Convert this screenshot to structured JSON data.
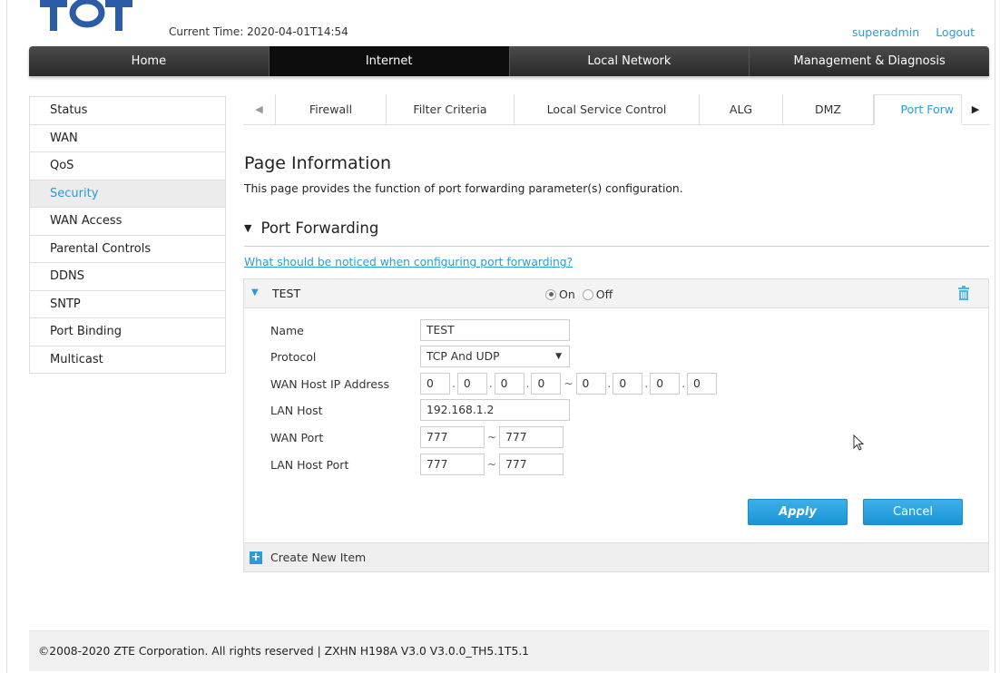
{
  "header": {
    "logo_text": "TOT",
    "current_time_label": "Current Time: 2020-04-01T14:54",
    "user": "superadmin",
    "logout": "Logout"
  },
  "main_nav": [
    "Home",
    "Internet",
    "Local Network",
    "Management & Diagnosis"
  ],
  "main_nav_active": "Internet",
  "sidebar": {
    "items": [
      "Status",
      "WAN",
      "QoS",
      "Security",
      "WAN Access",
      "Parental Controls",
      "DDNS",
      "SNTP",
      "Port Binding",
      "Multicast"
    ],
    "active": "Security"
  },
  "tabs": {
    "items": [
      "Firewall",
      "Filter Criteria",
      "Local Service Control",
      "ALG",
      "DMZ",
      "Port Forw"
    ],
    "active": "Port Forw"
  },
  "page": {
    "title": "Page Information",
    "description": "This page provides the function of port forwarding parameter(s) configuration.",
    "section_title": "Port Forwarding",
    "notice_link": "What should be noticed when configuring port forwarding?"
  },
  "item": {
    "name": "TEST",
    "on_label": "On",
    "off_label": "Off",
    "state": "On",
    "fields": {
      "name_label": "Name",
      "name_value": "TEST",
      "protocol_label": "Protocol",
      "protocol_value": "TCP And UDP",
      "wan_host_ip_label": "WAN Host IP Address",
      "wan_host_ip_start": [
        "0",
        "0",
        "0",
        "0"
      ],
      "wan_host_ip_end": [
        "0",
        "0",
        "0",
        "0"
      ],
      "lan_host_label": "LAN Host",
      "lan_host_value": "192.168.1.2",
      "wan_port_label": "WAN Port",
      "wan_port_start": "777",
      "wan_port_end": "777",
      "lan_host_port_label": "LAN Host Port",
      "lan_host_port_start": "777",
      "lan_host_port_end": "777"
    },
    "apply_label": "Apply",
    "cancel_label": "Cancel",
    "create_new_label": "Create New Item"
  },
  "footer": {
    "copyright": "©2008-2020 ZTE Corporation. All rights reserved  |  ZXHN H198A V3.0 V3.0.0_TH5.1T5.1"
  },
  "colors": {
    "accent": "#2a9bd6",
    "nav_bg": "#2a2a2a",
    "button": "#1a94d3"
  }
}
